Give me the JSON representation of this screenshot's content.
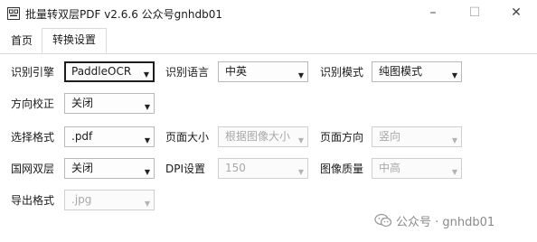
{
  "window": {
    "title": "批量转双层PDF v2.6.6 公众号gnhdb01",
    "minimize_glyph": "–",
    "maximize_glyph": "☐",
    "close_glyph": "✕",
    "icon": "app-icon"
  },
  "tabs": [
    {
      "label": "首页",
      "active": false
    },
    {
      "label": "转换设置",
      "active": true
    }
  ],
  "form": {
    "engine": {
      "label": "识别引擎",
      "value": "PaddleOCR"
    },
    "language": {
      "label": "识别语言",
      "value": "中英"
    },
    "mode": {
      "label": "识别模式",
      "value": "纯图模式"
    },
    "orientation_fix": {
      "label": "方向校正",
      "value": "关闭"
    },
    "select_format": {
      "label": "选择格式",
      "value": ".pdf"
    },
    "page_size": {
      "label": "页面大小",
      "value": "根据图像大小",
      "disabled": true
    },
    "page_orientation": {
      "label": "页面方向",
      "value": "竖向",
      "disabled": true
    },
    "national_double": {
      "label": "国网双层",
      "value": "关闭"
    },
    "dpi": {
      "label": "DPI设置",
      "value": "150",
      "disabled": true
    },
    "image_quality": {
      "label": "图像质量",
      "value": "中高",
      "disabled": true
    },
    "export_format": {
      "label": "导出格式",
      "value": ".jpg",
      "disabled": true
    }
  },
  "dropdown_arrow": "▼",
  "watermark": {
    "text": "公众号 · gnhdb01",
    "icon": "wechat-icon"
  }
}
